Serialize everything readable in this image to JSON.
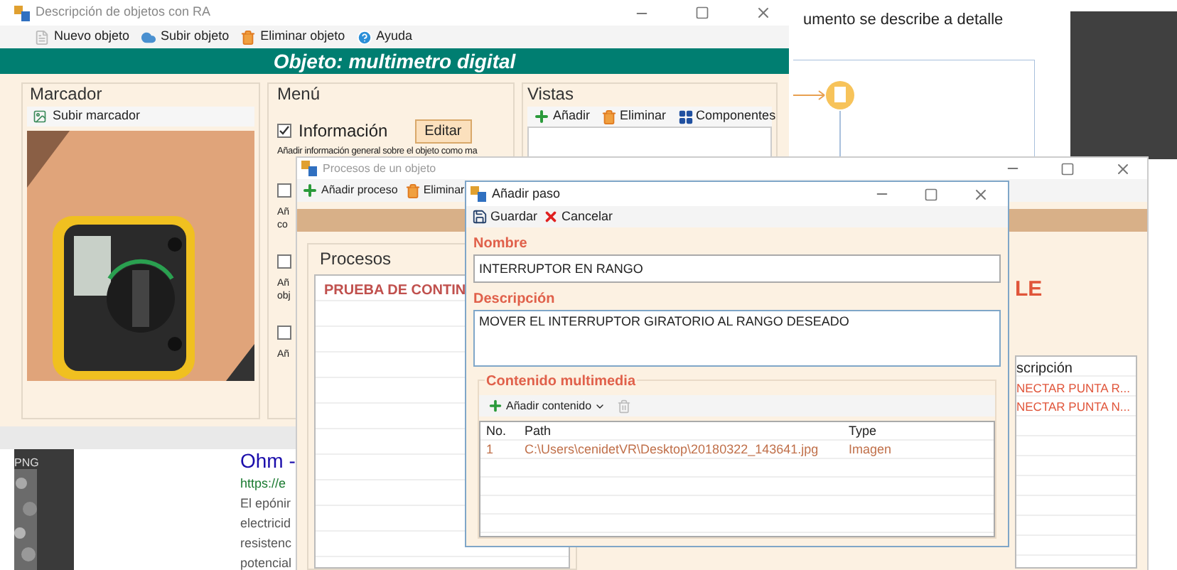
{
  "background": {
    "document_text": "umento se describe a detalle",
    "thumbnail_label": "PNG",
    "search_result": {
      "title": "Ohm -",
      "url": "https://e",
      "lines": [
        "El epónir",
        "electricid",
        "resistenc",
        "potencial"
      ]
    }
  },
  "main_window": {
    "title": "Descripción de objetos con RA",
    "toolbar": [
      "Nuevo objeto",
      "Subir objeto",
      "Eliminar objeto",
      "Ayuda"
    ],
    "banner": "Objeto: multimetro digital",
    "marker": {
      "title": "Marcador",
      "upload": "Subir marcador"
    },
    "menu": {
      "title": "Menú",
      "item": {
        "label": "Información",
        "checked": true,
        "button": "Editar",
        "description": "Añadir información general sobre el objeto como ma"
      },
      "fragments": [
        {
          "kind": "box",
          "checked": false
        },
        {
          "kind": "text",
          "lines": [
            "Añ",
            "co"
          ]
        },
        {
          "kind": "box",
          "checked": false
        },
        {
          "kind": "text",
          "lines": [
            "Añ",
            "obj"
          ]
        },
        {
          "kind": "box",
          "checked": false
        },
        {
          "kind": "text",
          "lines": [
            "Añ"
          ]
        }
      ]
    },
    "views": {
      "title": "Vistas",
      "toolbar": [
        "Añadir",
        "Eliminar",
        "Componentes"
      ]
    }
  },
  "process_window": {
    "title": "Procesos de un objeto",
    "toolbar": [
      "Añadir proceso",
      "Eliminar"
    ],
    "processes": {
      "title": "Procesos",
      "items": [
        "PRUEBA DE CONTIN"
      ]
    },
    "heading_fragment": "LE",
    "steps": {
      "column": "scripción",
      "rows": [
        "NECTAR PUNTA R...",
        "NECTAR PUNTA N..."
      ]
    }
  },
  "step_dialog": {
    "title": "Añadir paso",
    "toolbar": [
      "Guardar",
      "Cancelar"
    ],
    "name_label": "Nombre",
    "name_value": "INTERRUPTOR EN RANGO",
    "description_label": "Descripción",
    "description_value": "MOVER EL INTERRUPTOR GIRATORIO AL RANGO DESEADO",
    "media": {
      "title": "Contenido multimedia",
      "add_button": "Añadir contenido",
      "columns": [
        "No.",
        "Path",
        "Type"
      ],
      "rows": [
        [
          "1",
          "C:\\Users\\cenidetVR\\Desktop\\20180322_143641.jpg",
          "Imagen"
        ]
      ]
    }
  }
}
